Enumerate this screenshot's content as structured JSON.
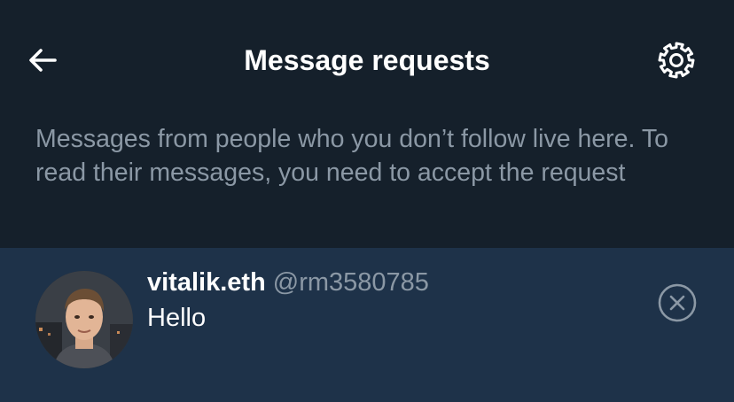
{
  "header": {
    "title": "Message requests",
    "back_icon": "arrow-left-icon",
    "settings_icon": "gear-icon"
  },
  "info": {
    "text": "Messages from people who you don’t follow live here. To read their messages, you need to accept the request"
  },
  "requests": [
    {
      "display_name": "vitalik.eth",
      "handle": "@rm3580785",
      "message": "Hello",
      "dismiss_icon": "close-circle-icon"
    }
  ],
  "colors": {
    "background": "#15202b",
    "row_background": "#1e3249",
    "secondary_text": "#8b98a5",
    "primary_text": "#ffffff"
  }
}
